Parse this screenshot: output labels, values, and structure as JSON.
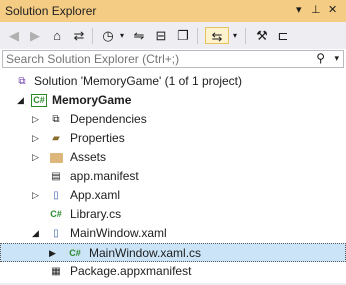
{
  "panel": {
    "title": "Solution Explorer",
    "accent": "#f5cc84"
  },
  "toolbar": {
    "buttons": [
      {
        "name": "back-icon",
        "glyph": "⊖"
      },
      {
        "name": "forward-icon",
        "glyph": "⊕"
      },
      {
        "name": "home-icon",
        "glyph": "⌂"
      },
      {
        "name": "switch-views-icon",
        "glyph": "⇄"
      },
      {
        "name": "pending-changes-filter-icon",
        "glyph": "◷"
      },
      {
        "name": "sync-icon",
        "glyph": "⇋"
      },
      {
        "name": "collapse-all-icon",
        "glyph": "⊟"
      },
      {
        "name": "show-all-files-icon",
        "glyph": "❐"
      },
      {
        "name": "track-active-item-icon",
        "glyph": "⇆"
      },
      {
        "name": "properties-icon",
        "glyph": "🔧"
      },
      {
        "name": "preview-icon",
        "glyph": "⊏"
      }
    ]
  },
  "search": {
    "placeholder": "Search Solution Explorer (Ctrl+;)"
  },
  "tree": {
    "solution": "Solution 'MemoryGame' (1 of 1 project)",
    "project": "MemoryGame",
    "project_badge": "C#",
    "items": [
      {
        "label": "Dependencies"
      },
      {
        "label": "Properties"
      },
      {
        "label": "Assets"
      },
      {
        "label": "app.manifest"
      },
      {
        "label": "App.xaml"
      },
      {
        "label": "Library.cs",
        "badge": "C#"
      },
      {
        "label": "MainWindow.xaml"
      },
      {
        "label": "MainWindow.xaml.cs",
        "badge": "C#"
      },
      {
        "label": "Package.appxmanifest"
      }
    ]
  }
}
